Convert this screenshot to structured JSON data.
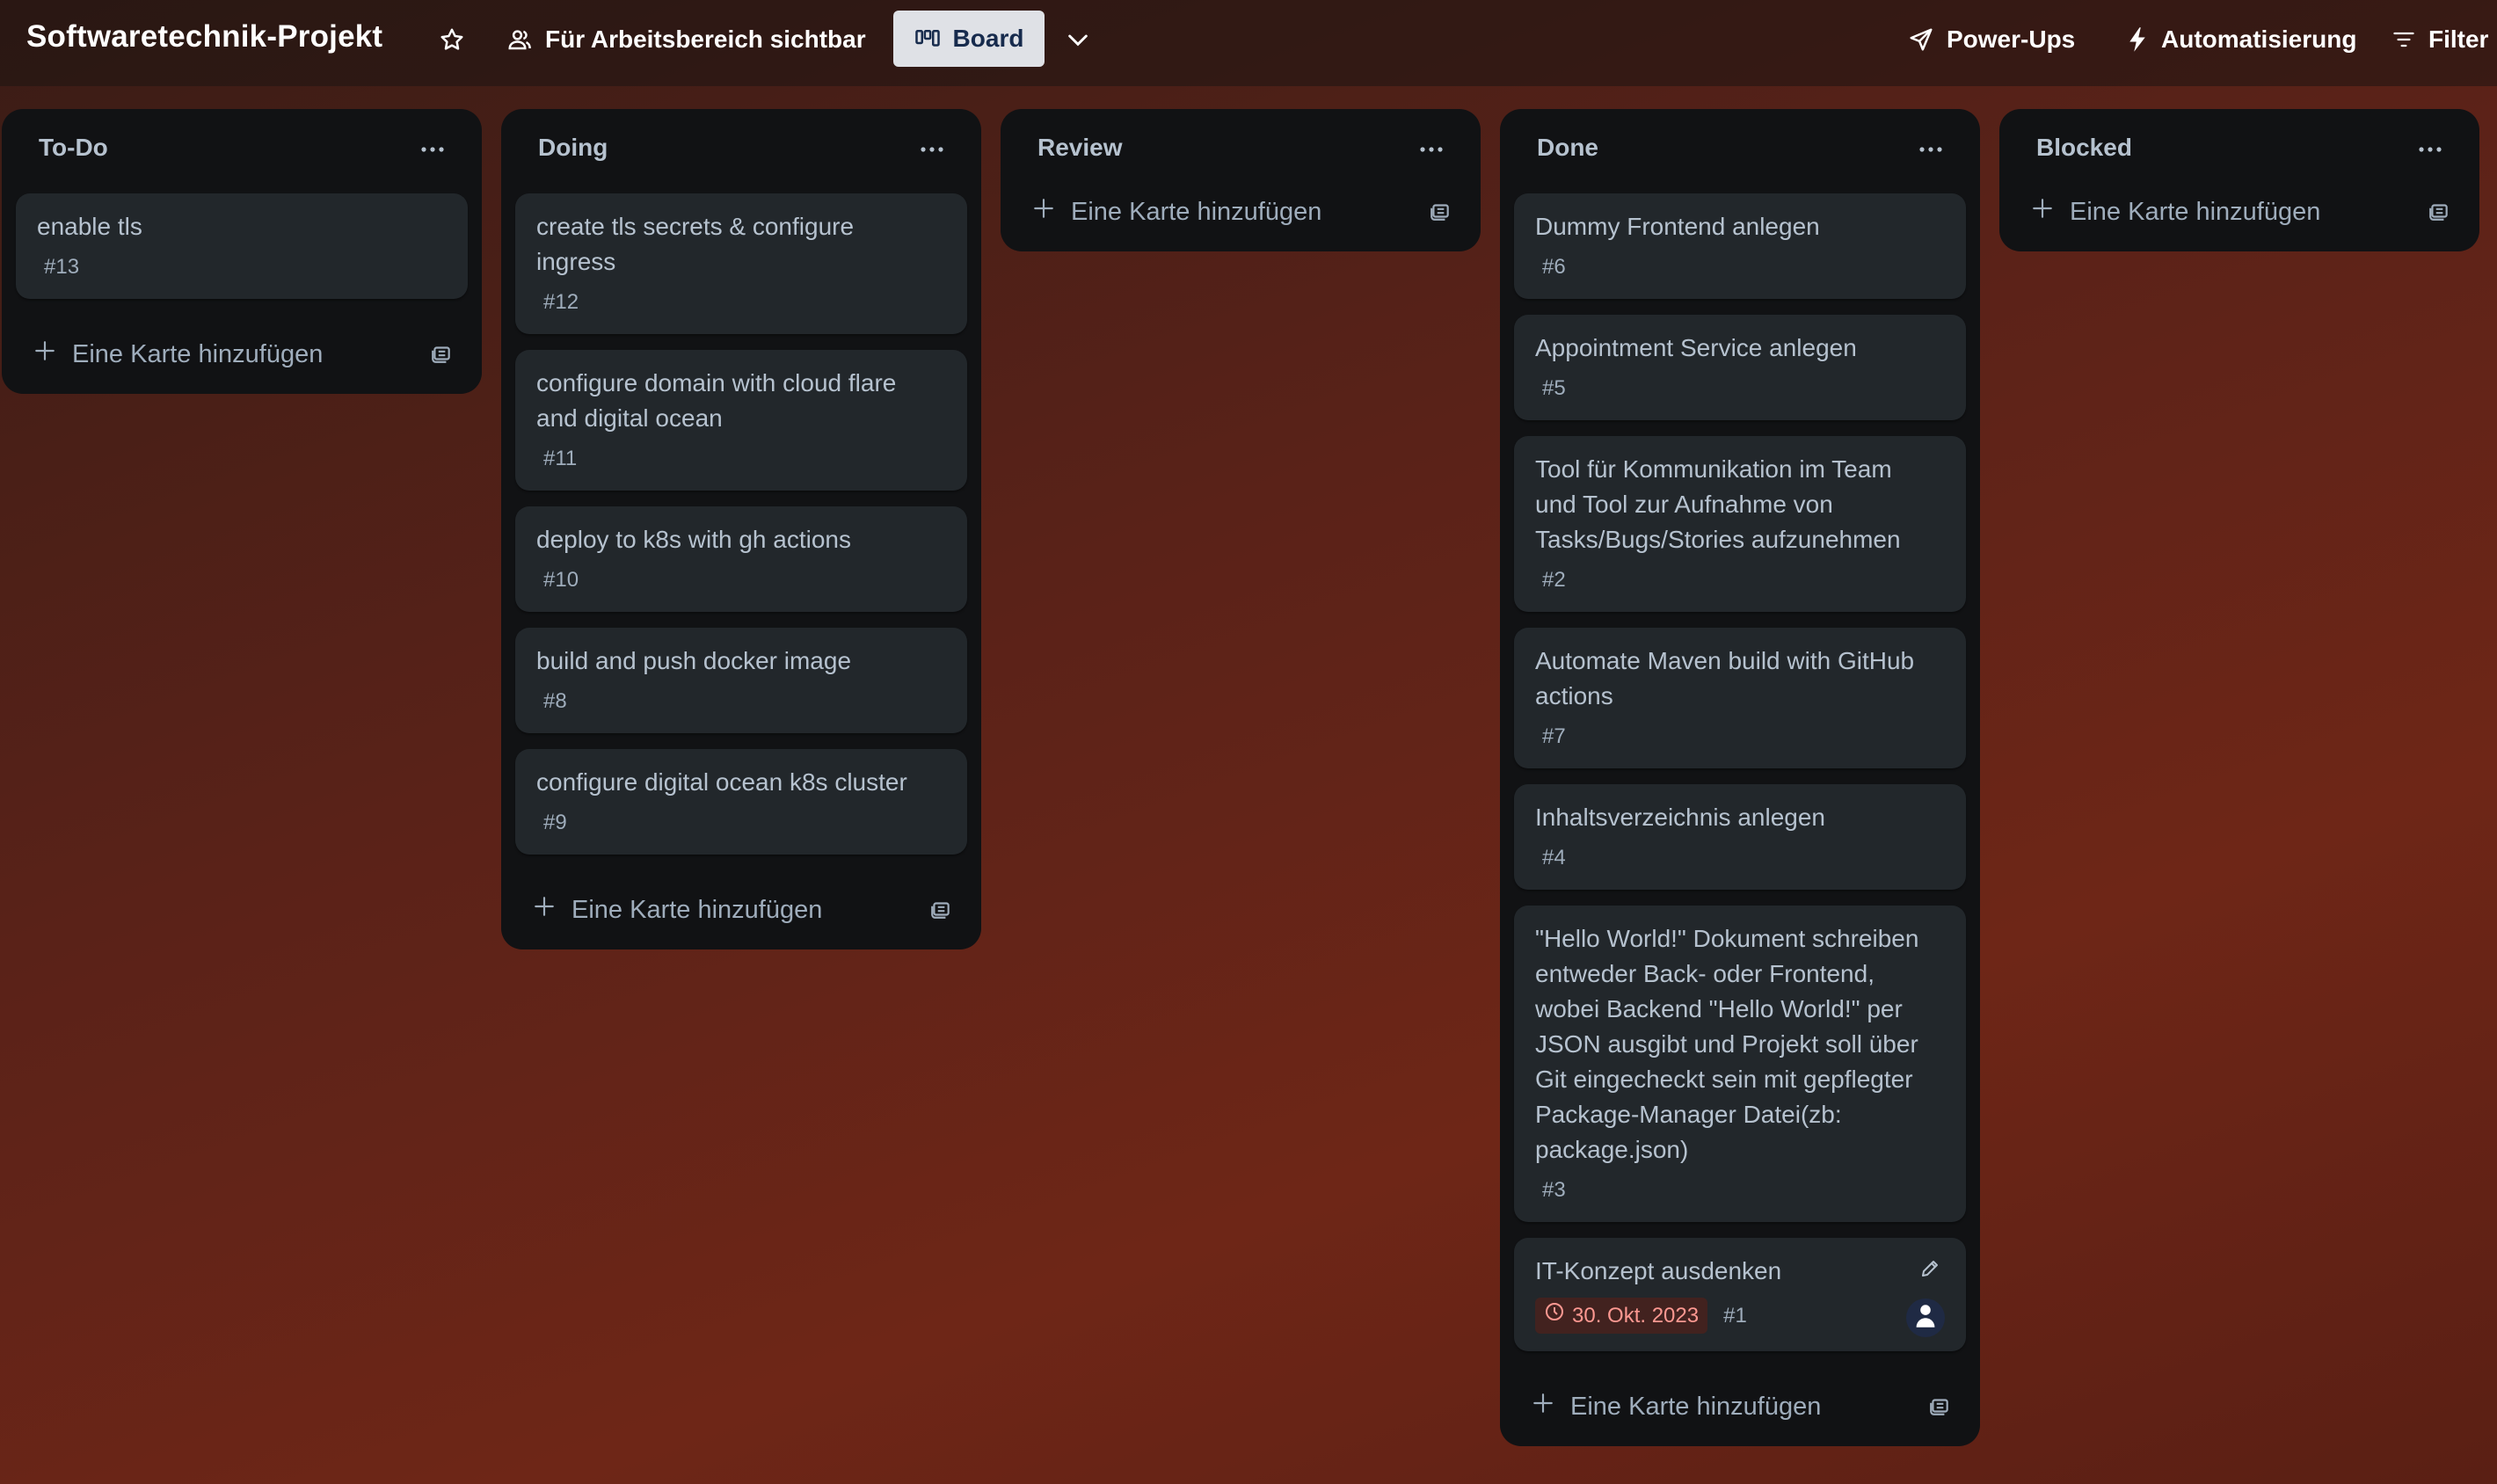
{
  "header": {
    "title": "Softwaretechnik-Projekt",
    "visibility_label": "Für Arbeitsbereich sichtbar",
    "view_label": "Board",
    "powerups_label": "Power-Ups",
    "automation_label": "Automatisierung",
    "filter_label": "Filter"
  },
  "add_card_label": "Eine Karte hinzufügen",
  "colors": {
    "list_bg": "#111214",
    "card_bg": "#22272b",
    "text": "#b6c2cf",
    "due_bg": "#42221f",
    "due_text": "#fd9891"
  },
  "lists": [
    {
      "title": "To-Do",
      "cards": [
        {
          "title": "enable tls",
          "number": "#13"
        }
      ]
    },
    {
      "title": "Doing",
      "cards": [
        {
          "title": "create tls secrets & configure\ningress",
          "number": "#12"
        },
        {
          "title": "configure domain with cloud flare\nand digital ocean",
          "number": "#11"
        },
        {
          "title": "deploy to k8s with gh actions",
          "number": "#10"
        },
        {
          "title": "build and push docker image",
          "number": "#8"
        },
        {
          "title": "configure digital ocean k8s cluster",
          "number": "#9"
        }
      ]
    },
    {
      "title": "Review",
      "cards": []
    },
    {
      "title": "Done",
      "cards": [
        {
          "title": "Dummy Frontend anlegen",
          "number": "#6"
        },
        {
          "title": "Appointment Service anlegen",
          "number": "#5"
        },
        {
          "title": "Tool für Kommunikation im Team\nund Tool zur Aufnahme von\nTasks/Bugs/Stories aufzunehmen",
          "number": "#2"
        },
        {
          "title": "Automate Maven build with GitHub\nactions",
          "number": "#7"
        },
        {
          "title": "Inhaltsverzeichnis anlegen",
          "number": "#4"
        },
        {
          "title": "\"Hello World!\" Dokument schreiben\nentweder Back- oder Frontend,\nwobei Backend \"Hello World!\" per\nJSON ausgibt und Projekt soll über\nGit eingecheckt sein mit gepflegter\nPackage-Manager Datei(zb:\npackage.json)",
          "number": "#3"
        },
        {
          "title": "IT-Konzept ausdenken",
          "number": "#1",
          "due": "30. Okt. 2023"
        }
      ]
    },
    {
      "title": "Blocked",
      "cards": []
    }
  ]
}
